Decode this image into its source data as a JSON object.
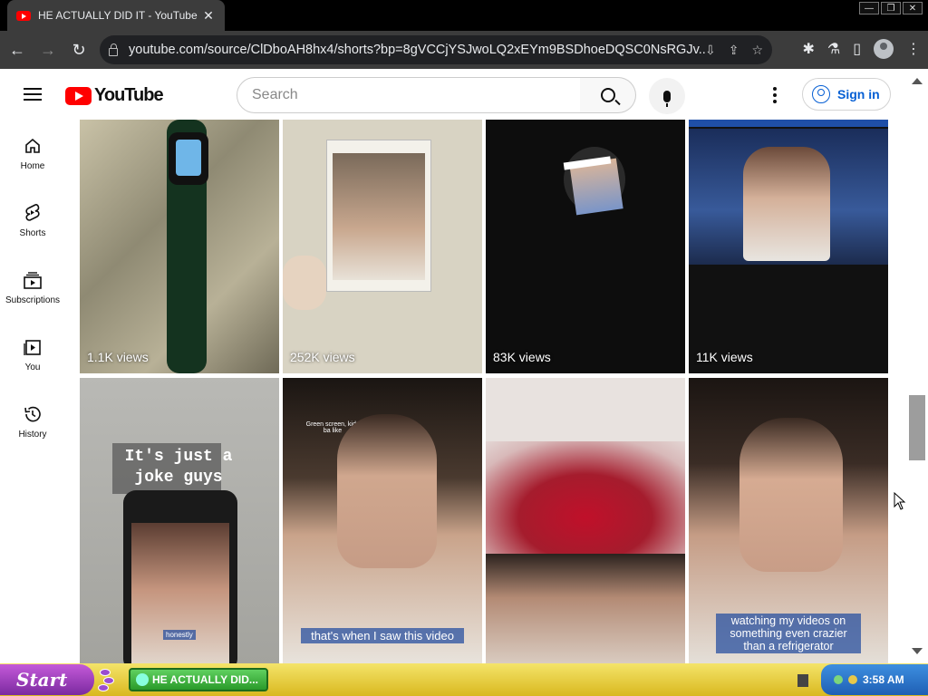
{
  "browser": {
    "tab_title": "HE ACTUALLY DID IT  - YouTube",
    "tab_close": "✕",
    "window_controls": [
      "—",
      "❐",
      "✕"
    ],
    "url": "youtube.com/source/ClDboAH8hx4/shorts?bp=8gVCCjYSJwoLQ2xEYm9BSDhoeDQSC0NsRGJv..."
  },
  "header": {
    "logo_text": "YouTube",
    "search_placeholder": "Search",
    "signin_label": "Sign in"
  },
  "sidebar": {
    "items": [
      {
        "label": "Home",
        "icon": "home-icon"
      },
      {
        "label": "Shorts",
        "icon": "shorts-icon"
      },
      {
        "label": "Subscriptions",
        "icon": "subscriptions-icon"
      },
      {
        "label": "You",
        "icon": "you-icon"
      },
      {
        "label": "History",
        "icon": "history-icon"
      }
    ]
  },
  "shorts": [
    {
      "views": "1.1K views"
    },
    {
      "views": "252K views"
    },
    {
      "views": "83K views"
    },
    {
      "views": "11K views"
    },
    {
      "overlay_text_line1": "It's just a",
      "overlay_text_line2": "joke guys",
      "phone_caption": "honestly"
    },
    {
      "top_text": "Green screen, kids ba like",
      "caption": "that's when I saw this video"
    },
    {},
    {
      "caption": "watching my videos on something even crazier than a refrigerator"
    }
  ],
  "taskbar": {
    "start_label": "Start",
    "task_label": "HE ACTUALLY DID...",
    "clock": "3:58 AM"
  },
  "colors": {
    "youtube_red": "#ff0000",
    "link_blue": "#065fd4",
    "chrome_dark": "#3c3c3c"
  }
}
